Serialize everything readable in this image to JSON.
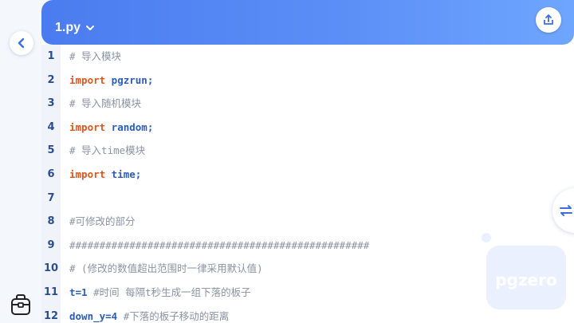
{
  "header": {
    "file_name": "1.py",
    "dropdown_icon": "chevron-down-icon",
    "share_icon": "share-icon"
  },
  "navigation": {
    "back_icon": "chevron-left-icon",
    "bag_icon": "bag-icon",
    "toggle_icon": "swap-arrows-icon"
  },
  "watermark_text": "pgzero",
  "colors": {
    "header_start": "#4a7cf0",
    "header_end": "#6ea6ff",
    "keyword": "#e2541a",
    "name": "#2c5db8",
    "comment": "#8a93a3",
    "line_number": "#2a4e8f"
  },
  "code_lines": [
    {
      "number": "1",
      "parts": [
        {
          "t": "# 导入模块",
          "k": "cm"
        }
      ]
    },
    {
      "number": "2",
      "parts": [
        {
          "t": "import",
          "k": "kw"
        },
        {
          "t": " pgzrun;",
          "k": "nm"
        }
      ]
    },
    {
      "number": "3",
      "parts": [
        {
          "t": "# 导入随机模块",
          "k": "cm"
        }
      ]
    },
    {
      "number": "4",
      "parts": [
        {
          "t": "import",
          "k": "kw"
        },
        {
          "t": " random;",
          "k": "nm"
        }
      ]
    },
    {
      "number": "5",
      "parts": [
        {
          "t": "# 导入time模块",
          "k": "cm"
        }
      ]
    },
    {
      "number": "6",
      "parts": [
        {
          "t": "import",
          "k": "kw"
        },
        {
          "t": " time;",
          "k": "nm"
        }
      ]
    },
    {
      "number": "7",
      "parts": []
    },
    {
      "number": "8",
      "parts": [
        {
          "t": "#可修改的部分",
          "k": "cm"
        }
      ]
    },
    {
      "number": "9",
      "parts": [
        {
          "t": "##################################################",
          "k": "cm"
        }
      ]
    },
    {
      "number": "10",
      "parts": [
        {
          "t": "# (修改的数值超出范围时一律采用默认值)",
          "k": "cm"
        }
      ]
    },
    {
      "number": "11",
      "parts": [
        {
          "t": "t=1",
          "k": "nm"
        },
        {
          "t": " #时间 每隔t秒生成一组下落的板子",
          "k": "cm"
        }
      ]
    },
    {
      "number": "12",
      "parts": [
        {
          "t": "down_y=4",
          "k": "nm"
        },
        {
          "t": " #下落的板子移动的距离",
          "k": "cm"
        }
      ]
    }
  ]
}
